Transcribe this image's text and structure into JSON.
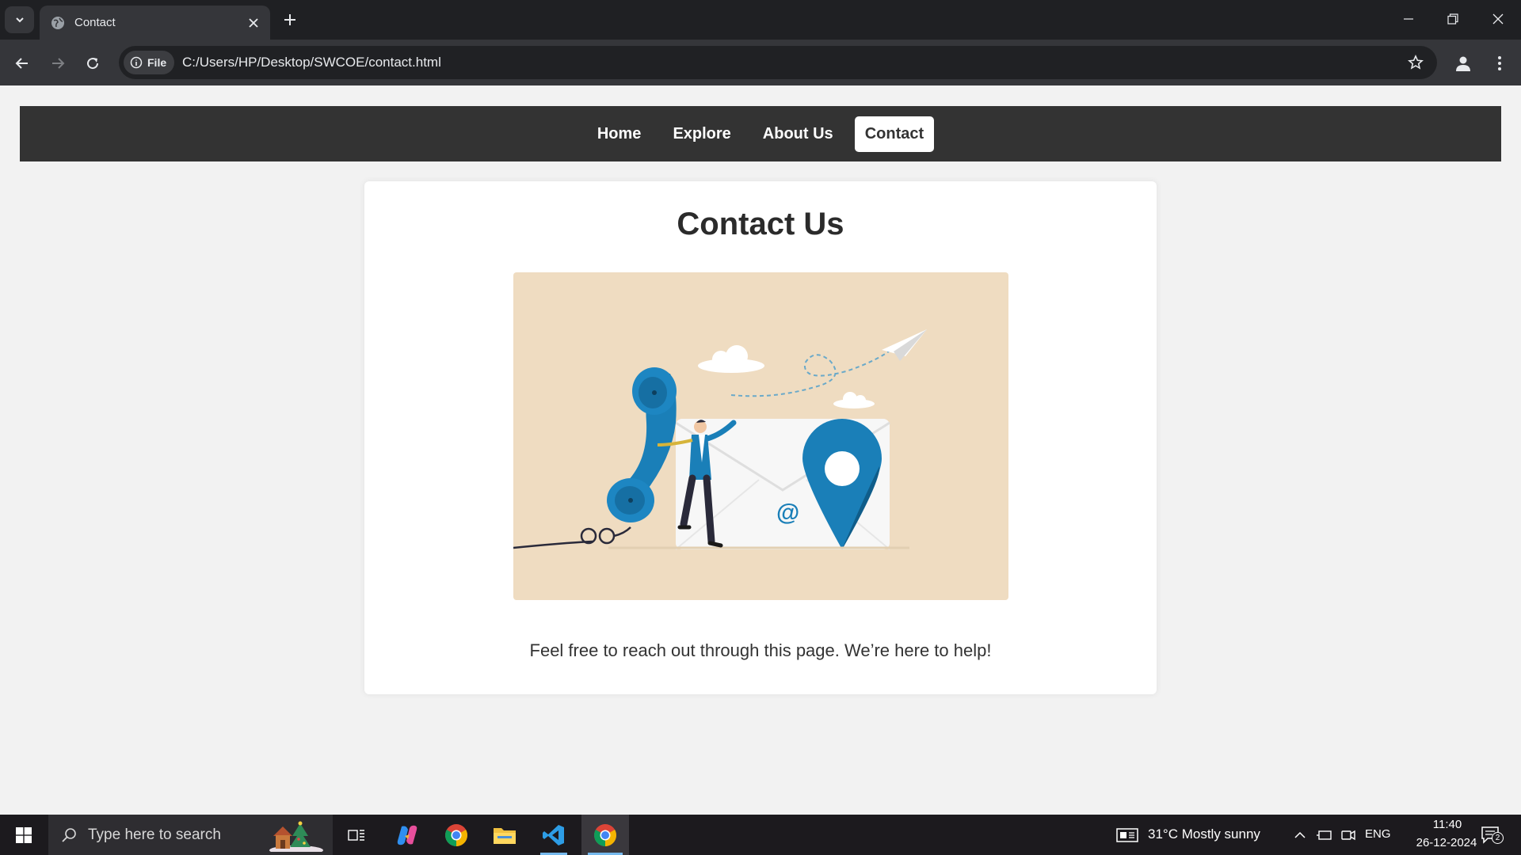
{
  "browser": {
    "tab_title": "Contact",
    "site_chip_label": "File",
    "url": "C:/Users/HP/Desktop/SWCOE/contact.html"
  },
  "nav": {
    "items": [
      {
        "label": "Home",
        "active": false
      },
      {
        "label": "Explore",
        "active": false
      },
      {
        "label": "About Us",
        "active": false
      },
      {
        "label": "Contact",
        "active": true
      }
    ]
  },
  "content": {
    "heading": "Contact Us",
    "message": "Feel free to reach out through this page. We’re here to help!"
  },
  "taskbar": {
    "search_placeholder": "Type here to search",
    "weather": "31°C  Mostly sunny",
    "language": "ENG",
    "time": "11:40",
    "date": "26-12-2024",
    "notification_count": "2"
  },
  "colors": {
    "nav_bg": "#333333",
    "illustration_bg": "#efdcc1",
    "accent_blue": "#1a7fb8"
  }
}
